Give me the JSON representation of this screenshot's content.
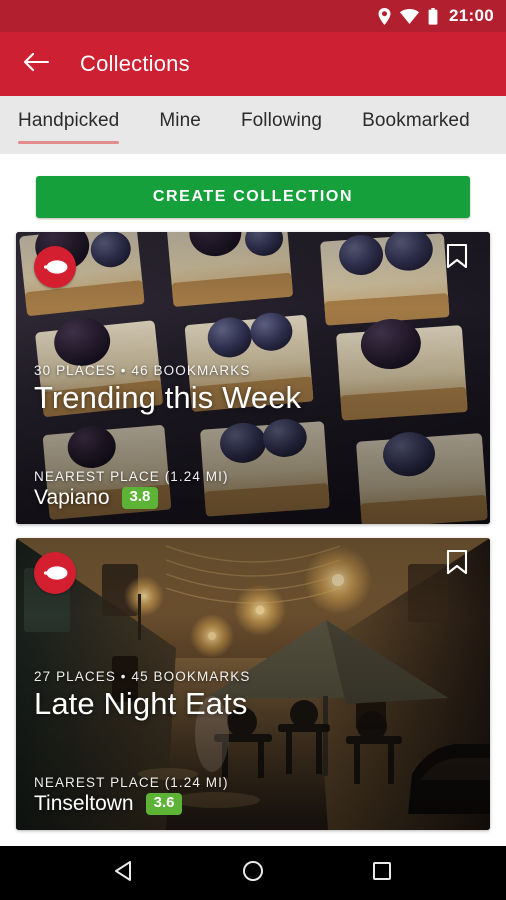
{
  "statusbar": {
    "time": "21:00",
    "icons": [
      "location-pin-icon",
      "wifi-icon",
      "battery-icon"
    ],
    "background": "#b22030"
  },
  "appbar": {
    "title": "Collections",
    "back_icon": "arrow-left-icon",
    "background": "#cd2032"
  },
  "tabs": {
    "background": "#e8e8e8",
    "active_index": 0,
    "indicator_color": "#e28c8c",
    "items": [
      {
        "label": "Handpicked"
      },
      {
        "label": "Mine"
      },
      {
        "label": "Following"
      },
      {
        "label": "Bookmarked"
      }
    ]
  },
  "cta": {
    "label": "CREATE COLLECTION",
    "color": "#16a03c"
  },
  "cards": [
    {
      "brand_icon": "spoon-logo-icon",
      "bookmark_icon": "bookmark-outline-icon",
      "meta": "30 PLACES • 46 BOOKMARKS",
      "title": "Trending this Week",
      "nearest_label": "NEAREST PLACE (1.24 MI)",
      "nearest_name": "Vapiano",
      "rating": "3.8",
      "rating_color": "#5cb335"
    },
    {
      "brand_icon": "spoon-logo-icon",
      "bookmark_icon": "bookmark-outline-icon",
      "meta": "27 PLACES • 45 BOOKMARKS",
      "title": "Late Night Eats",
      "nearest_label": "NEAREST PLACE (1.24 MI)",
      "nearest_name": "Tinseltown",
      "rating": "3.6",
      "rating_color": "#5cb335"
    }
  ],
  "navbar": {
    "background": "#000000",
    "buttons": [
      {
        "icon": "back-triangle-icon"
      },
      {
        "icon": "home-circle-icon"
      },
      {
        "icon": "recents-square-icon"
      }
    ]
  }
}
